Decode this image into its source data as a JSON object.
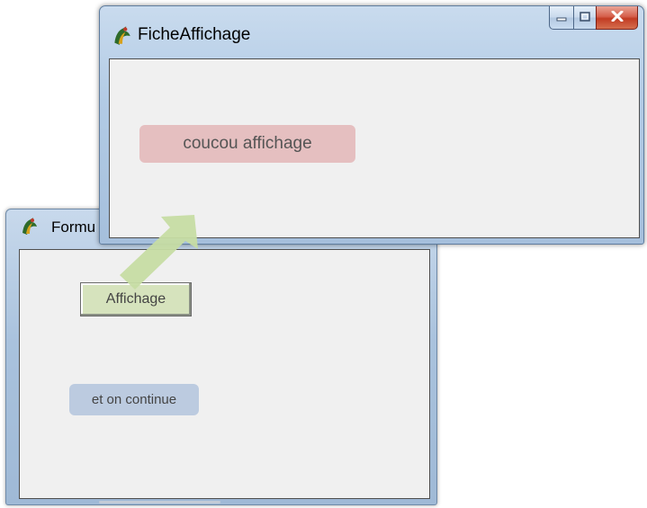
{
  "back_window": {
    "title": "Formu",
    "icon": "delphi-app-icon",
    "button_label": "Affichage",
    "label_text": "et on continue"
  },
  "front_window": {
    "title": "FicheAffichage",
    "icon": "delphi-app-icon",
    "label_text": "coucou affichage",
    "caption_buttons": {
      "minimize": "minimize-icon",
      "maximize": "maximize-icon",
      "close": "close-icon"
    }
  },
  "colors": {
    "button_green": "#d6e3bd",
    "label_blue": "#bccbe0",
    "label_pink": "#e5bfc0",
    "arrow_green": "#c6dca3",
    "close_red": "#c23b23"
  }
}
